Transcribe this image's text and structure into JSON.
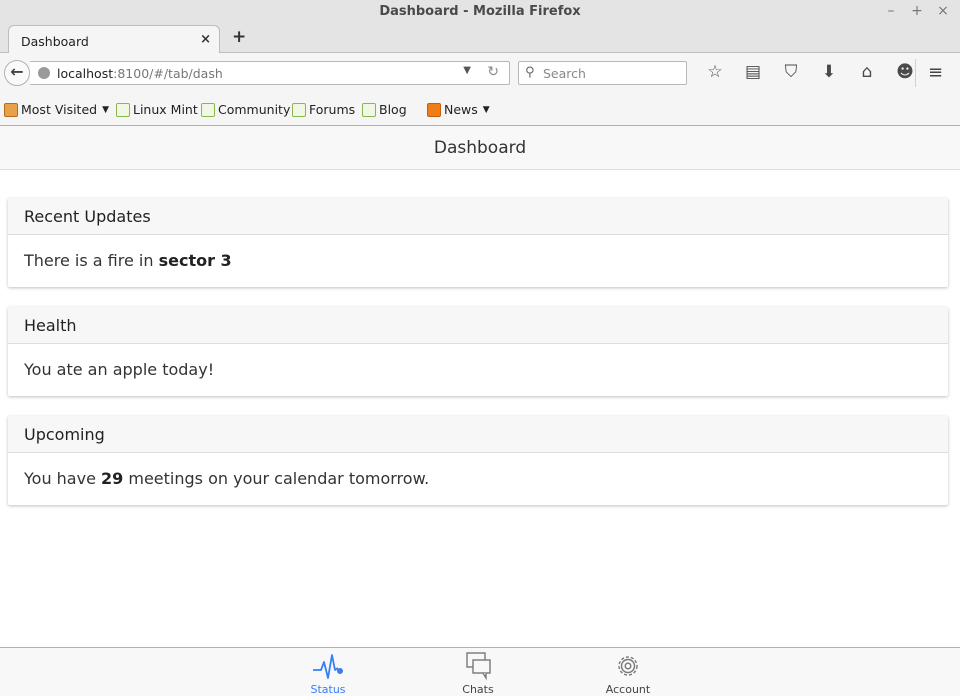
{
  "window": {
    "title": "Dashboard - Mozilla Firefox",
    "controls": [
      "–",
      "+",
      "×"
    ]
  },
  "tab": {
    "title": "Dashboard",
    "close": "×",
    "newtab": "+"
  },
  "nav": {
    "url_host": "localhost",
    "url_rest": ":8100/#/tab/dash",
    "search_placeholder": "Search"
  },
  "bookmarks": {
    "items": [
      {
        "label": "Most Visited",
        "icon": "folder-icon"
      },
      {
        "label": "Linux Mint",
        "icon": "mint-icon"
      },
      {
        "label": "Community",
        "icon": "mint-icon"
      },
      {
        "label": "Forums",
        "icon": "mint-icon"
      },
      {
        "label": "Blog",
        "icon": "mint-icon"
      },
      {
        "label": "News",
        "icon": "rss-icon"
      }
    ]
  },
  "app": {
    "header_title": "Dashboard",
    "cards": [
      {
        "title": "Recent Updates",
        "text_before": "There is a fire in ",
        "bold": "sector 3",
        "text_after": ""
      },
      {
        "title": "Health",
        "text_before": "You ate an apple today!",
        "bold": "",
        "text_after": ""
      },
      {
        "title": "Upcoming",
        "text_before": "You have ",
        "bold": "29",
        "text_after": " meetings on your calendar tomorrow."
      }
    ],
    "tabs": [
      {
        "label": "Status",
        "icon": "pulse-icon",
        "active": true
      },
      {
        "label": "Chats",
        "icon": "chat-icon",
        "active": false
      },
      {
        "label": "Account",
        "icon": "gear-icon",
        "active": false
      }
    ],
    "accent_color": "#387ef5"
  }
}
